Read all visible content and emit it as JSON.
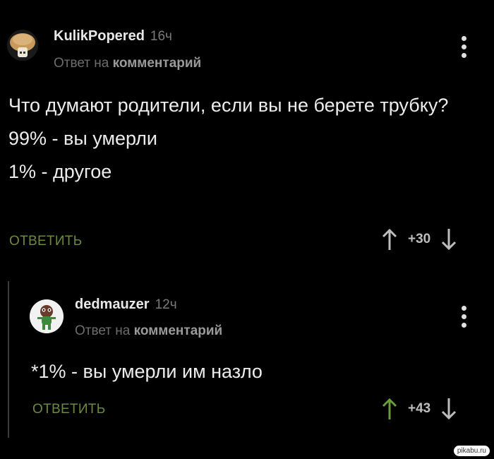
{
  "comments": [
    {
      "author": "KulikPopered",
      "time": "16ч",
      "reply_prefix": "Ответ на",
      "reply_target": "комментарий",
      "text_lines": [
        "Что думают родители, если вы не берете трубку?",
        "99% - вы умерли",
        "1% - другое"
      ],
      "reply_label": "ОТВЕТИТЬ",
      "score": "+30",
      "upvoted": false
    },
    {
      "author": "dedmauzer",
      "time": "12ч",
      "reply_prefix": "Ответ на",
      "reply_target": "комментарий",
      "text_lines": [
        "*1% - вы умерли им назло"
      ],
      "reply_label": "ОТВЕТИТЬ",
      "score": "+43",
      "upvoted": true
    }
  ],
  "watermark": "pikabu.ru",
  "colors": {
    "background": "#000000",
    "accent_green": "#6b8a3e",
    "upvote_active": "#6b9c3c",
    "muted": "#6d6d6d"
  }
}
